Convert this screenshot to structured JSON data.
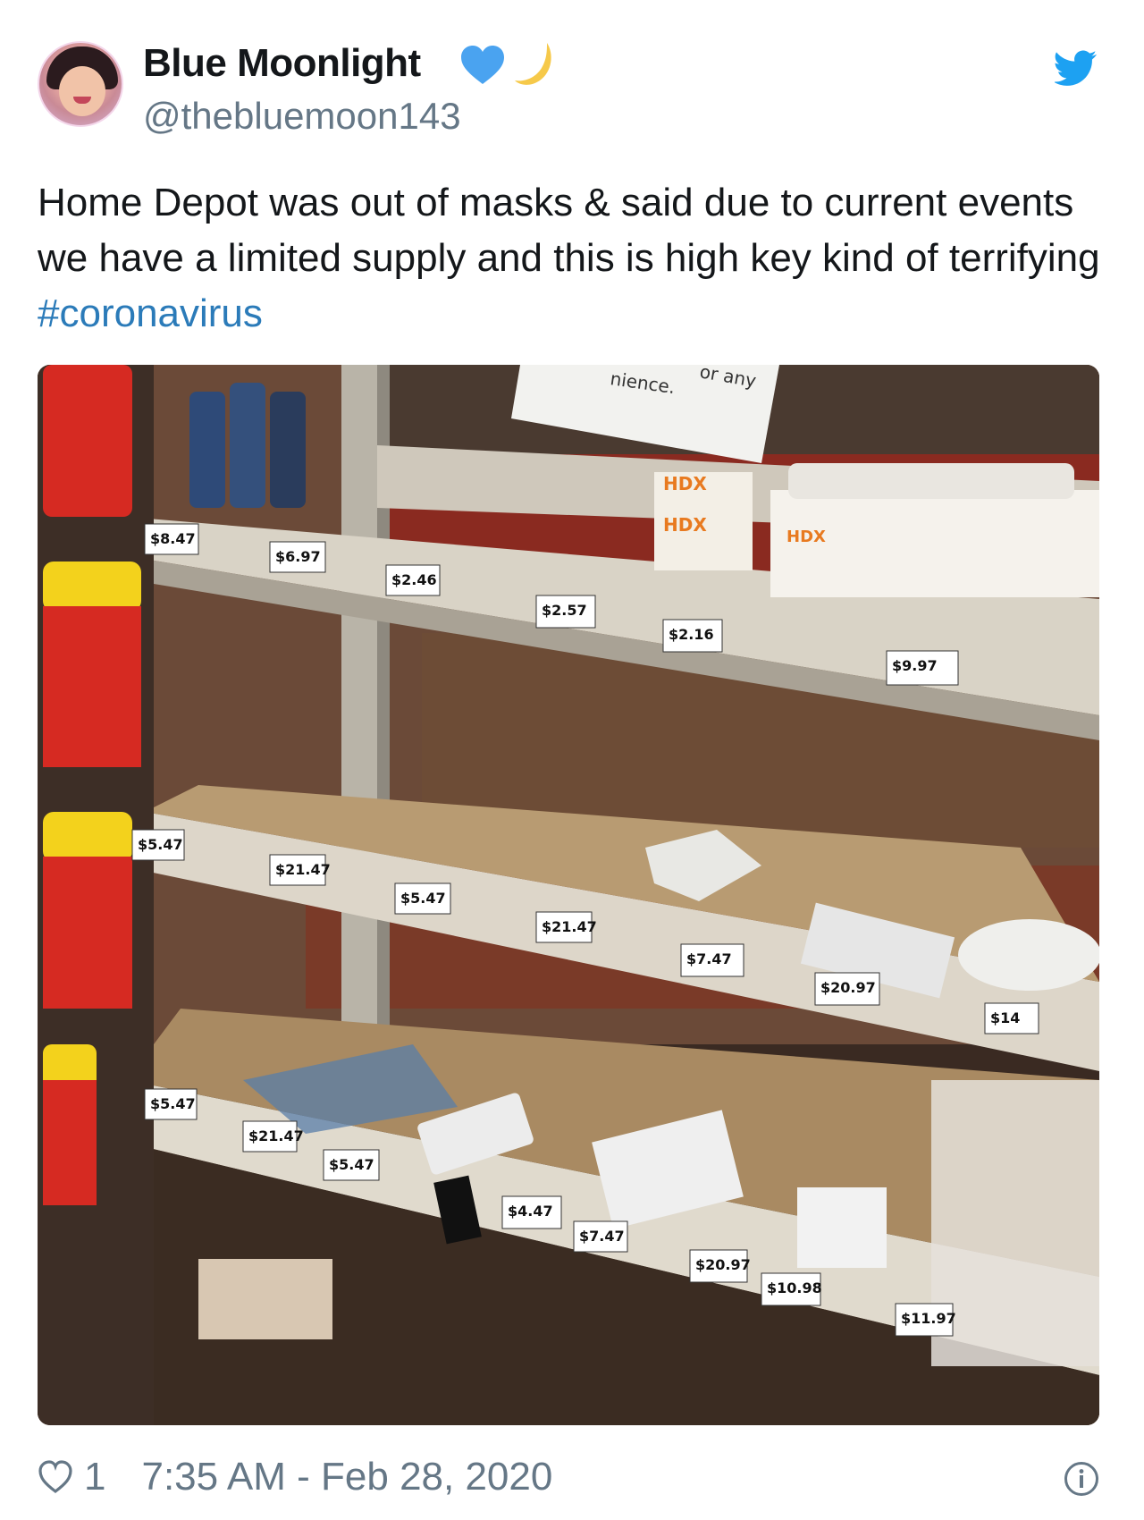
{
  "user": {
    "display_name": "Blue Moonlight",
    "handle": "@thebluemoon143",
    "avatar_icon": "profile-photo",
    "badges": [
      "blue-heart-icon",
      "crescent-moon-icon"
    ]
  },
  "brand_icon": "twitter-bird-icon",
  "tweet": {
    "text_main": "Home Depot was out of masks & said due to current events we have a limited supply and this is high key kind of terrifying ",
    "hashtag": "#coronavirus",
    "photo": {
      "sign_text": "nience.",
      "sign_text_2": "or any",
      "product_brand_1": "HDX",
      "product_brand_2": "HDX",
      "product_brand_3": "HDX",
      "price_tags": [
        "$8.47",
        "$6.97",
        "$2.46",
        "$2.57",
        "$2.16",
        "$9.97",
        "$5.47",
        "$21.47",
        "$5.47",
        "$21.47",
        "$7.47",
        "$20.97",
        "$14",
        "$5.47",
        "$21.47",
        "$5.47",
        "$4.47",
        "$7.47",
        "$20.97",
        "$10.98",
        "$11.97"
      ]
    }
  },
  "footer": {
    "like_count": "1",
    "timestamp": "7:35 AM - Feb 28, 2020"
  },
  "colors": {
    "text": "#14171a",
    "muted": "#657786",
    "link": "#2b7bb9",
    "twitter_blue": "#1da1f2"
  }
}
